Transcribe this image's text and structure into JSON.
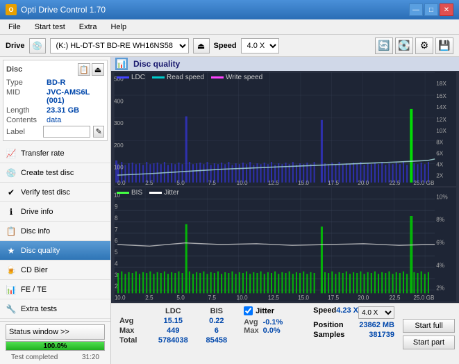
{
  "app": {
    "title": "Opti Drive Control 1.70",
    "icon": "O"
  },
  "titlebar": {
    "minimize": "—",
    "maximize": "□",
    "close": "✕"
  },
  "menu": {
    "items": [
      "File",
      "Start test",
      "Extra",
      "Help"
    ]
  },
  "drive_bar": {
    "label": "Drive",
    "drive_value": "(K:)  HL-DT-ST BD-RE  WH16NS58 TST4",
    "speed_label": "Speed",
    "speed_value": "4.0 X"
  },
  "disc_panel": {
    "title": "Disc",
    "fields": [
      {
        "key": "Type",
        "value": "BD-R"
      },
      {
        "key": "MID",
        "value": "JVC-AMS6L (001)"
      },
      {
        "key": "Length",
        "value": "23.31 GB"
      },
      {
        "key": "Contents",
        "value": "data"
      },
      {
        "key": "Label",
        "value": ""
      }
    ]
  },
  "nav": {
    "items": [
      {
        "id": "transfer-rate",
        "label": "Transfer rate",
        "icon": "📈"
      },
      {
        "id": "create-test-disc",
        "label": "Create test disc",
        "icon": "💿"
      },
      {
        "id": "verify-test-disc",
        "label": "Verify test disc",
        "icon": "✔"
      },
      {
        "id": "drive-info",
        "label": "Drive info",
        "icon": "ℹ"
      },
      {
        "id": "disc-info",
        "label": "Disc info",
        "icon": "📋"
      },
      {
        "id": "disc-quality",
        "label": "Disc quality",
        "icon": "★",
        "active": true
      },
      {
        "id": "cd-bier",
        "label": "CD Bier",
        "icon": "🍺"
      },
      {
        "id": "fe-te",
        "label": "FE / TE",
        "icon": "📊"
      },
      {
        "id": "extra-tests",
        "label": "Extra tests",
        "icon": "🔧"
      }
    ]
  },
  "status": {
    "window_btn": "Status window >>",
    "progress": 100.0,
    "progress_text": "100.0%",
    "time": "31:20",
    "status_text": "Test completed"
  },
  "chart": {
    "title": "Disc quality",
    "legend_top": [
      {
        "label": "LDC",
        "color": "#4444ff"
      },
      {
        "label": "Read speed",
        "color": "#00cccc"
      },
      {
        "label": "Write speed",
        "color": "#ff44ff"
      }
    ],
    "legend_bottom": [
      {
        "label": "BIS",
        "color": "#44ff44"
      },
      {
        "label": "Jitter",
        "color": "#ffffff"
      }
    ],
    "x_labels": [
      "0.0",
      "2.5",
      "5.0",
      "7.5",
      "10.0",
      "12.5",
      "15.0",
      "17.5",
      "20.0",
      "22.5",
      "25.0 GB"
    ],
    "top_y_labels": [
      "500",
      "400",
      "300",
      "200",
      "100"
    ],
    "top_y_right": [
      "18X",
      "16X",
      "14X",
      "12X",
      "10X",
      "8X",
      "6X",
      "4X",
      "2X"
    ],
    "bottom_y_labels": [
      "10",
      "9",
      "8",
      "7",
      "6",
      "5",
      "4",
      "3",
      "2",
      "1"
    ],
    "bottom_y_right": [
      "10%",
      "8%",
      "6%",
      "4%",
      "2%"
    ]
  },
  "stats": {
    "columns": [
      "",
      "LDC",
      "BIS",
      "",
      "Jitter",
      "Speed"
    ],
    "rows": [
      {
        "label": "Avg",
        "ldc": "15.15",
        "bis": "0.22",
        "jitter": "-0.1%",
        "speed_label": ""
      },
      {
        "label": "Max",
        "ldc": "449",
        "bis": "6",
        "jitter": "0.0%",
        "speed_label": "Position",
        "speed_val": "23862 MB"
      },
      {
        "label": "Total",
        "ldc": "5784038",
        "bis": "85458",
        "jitter": "",
        "speed_label": "Samples",
        "speed_val": "381739"
      }
    ],
    "speed_display": "4.23 X",
    "speed_select": "4.0 X",
    "jitter_checked": true,
    "jitter_label": "Jitter"
  },
  "buttons": {
    "start_full": "Start full",
    "start_part": "Start part"
  }
}
